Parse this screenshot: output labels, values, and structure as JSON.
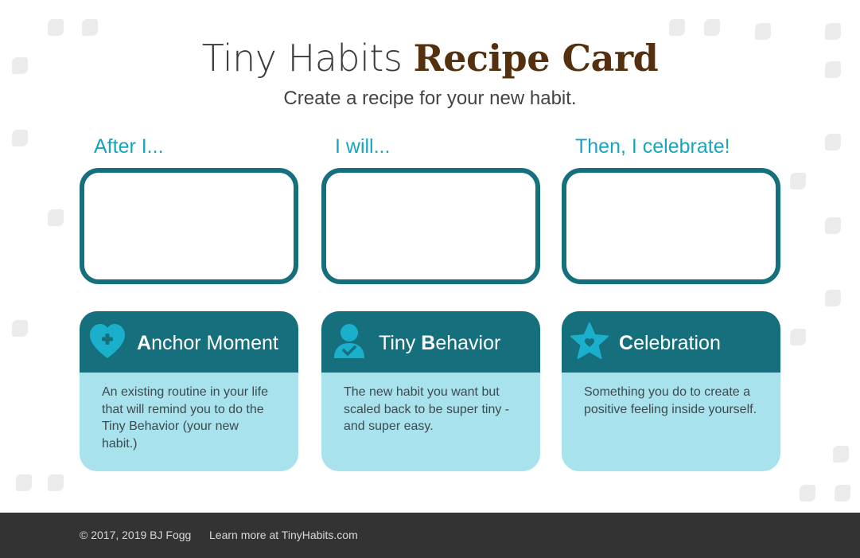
{
  "header": {
    "title_light": "Tiny Habits ",
    "title_bold": "Recipe Card",
    "subtitle": "Create a recipe for your new habit."
  },
  "columns": [
    {
      "label": "After I...",
      "input_value": ""
    },
    {
      "label": "I will...",
      "input_value": ""
    },
    {
      "label": "Then, I celebrate!",
      "input_value": ""
    }
  ],
  "cards": [
    {
      "icon": "heart-plus-icon",
      "title_initial": "A",
      "title_rest": "nchor Moment",
      "title_prefix": "",
      "description": "An existing routine in your life that will remind you to do the Tiny Behavior (your new habit.)"
    },
    {
      "icon": "person-check-icon",
      "title_prefix": "Tiny ",
      "title_initial": "B",
      "title_rest": "ehavior",
      "description": "The new habit you want but scaled back to be super tiny - and super easy."
    },
    {
      "icon": "star-heart-icon",
      "title_prefix": "",
      "title_initial": "C",
      "title_rest": "elebration",
      "description": "Something you do to create a positive feeling inside yourself."
    }
  ],
  "footer": {
    "copyright": "© 2017, 2019 BJ Fogg",
    "learn_more": "Learn more at TinyHabits.com"
  },
  "colors": {
    "brand_teal": "#166f7d",
    "label_cyan": "#16a5c0",
    "card_light": "#a8e2ec",
    "title_brown": "#55300f",
    "footer_bg": "#333333"
  }
}
